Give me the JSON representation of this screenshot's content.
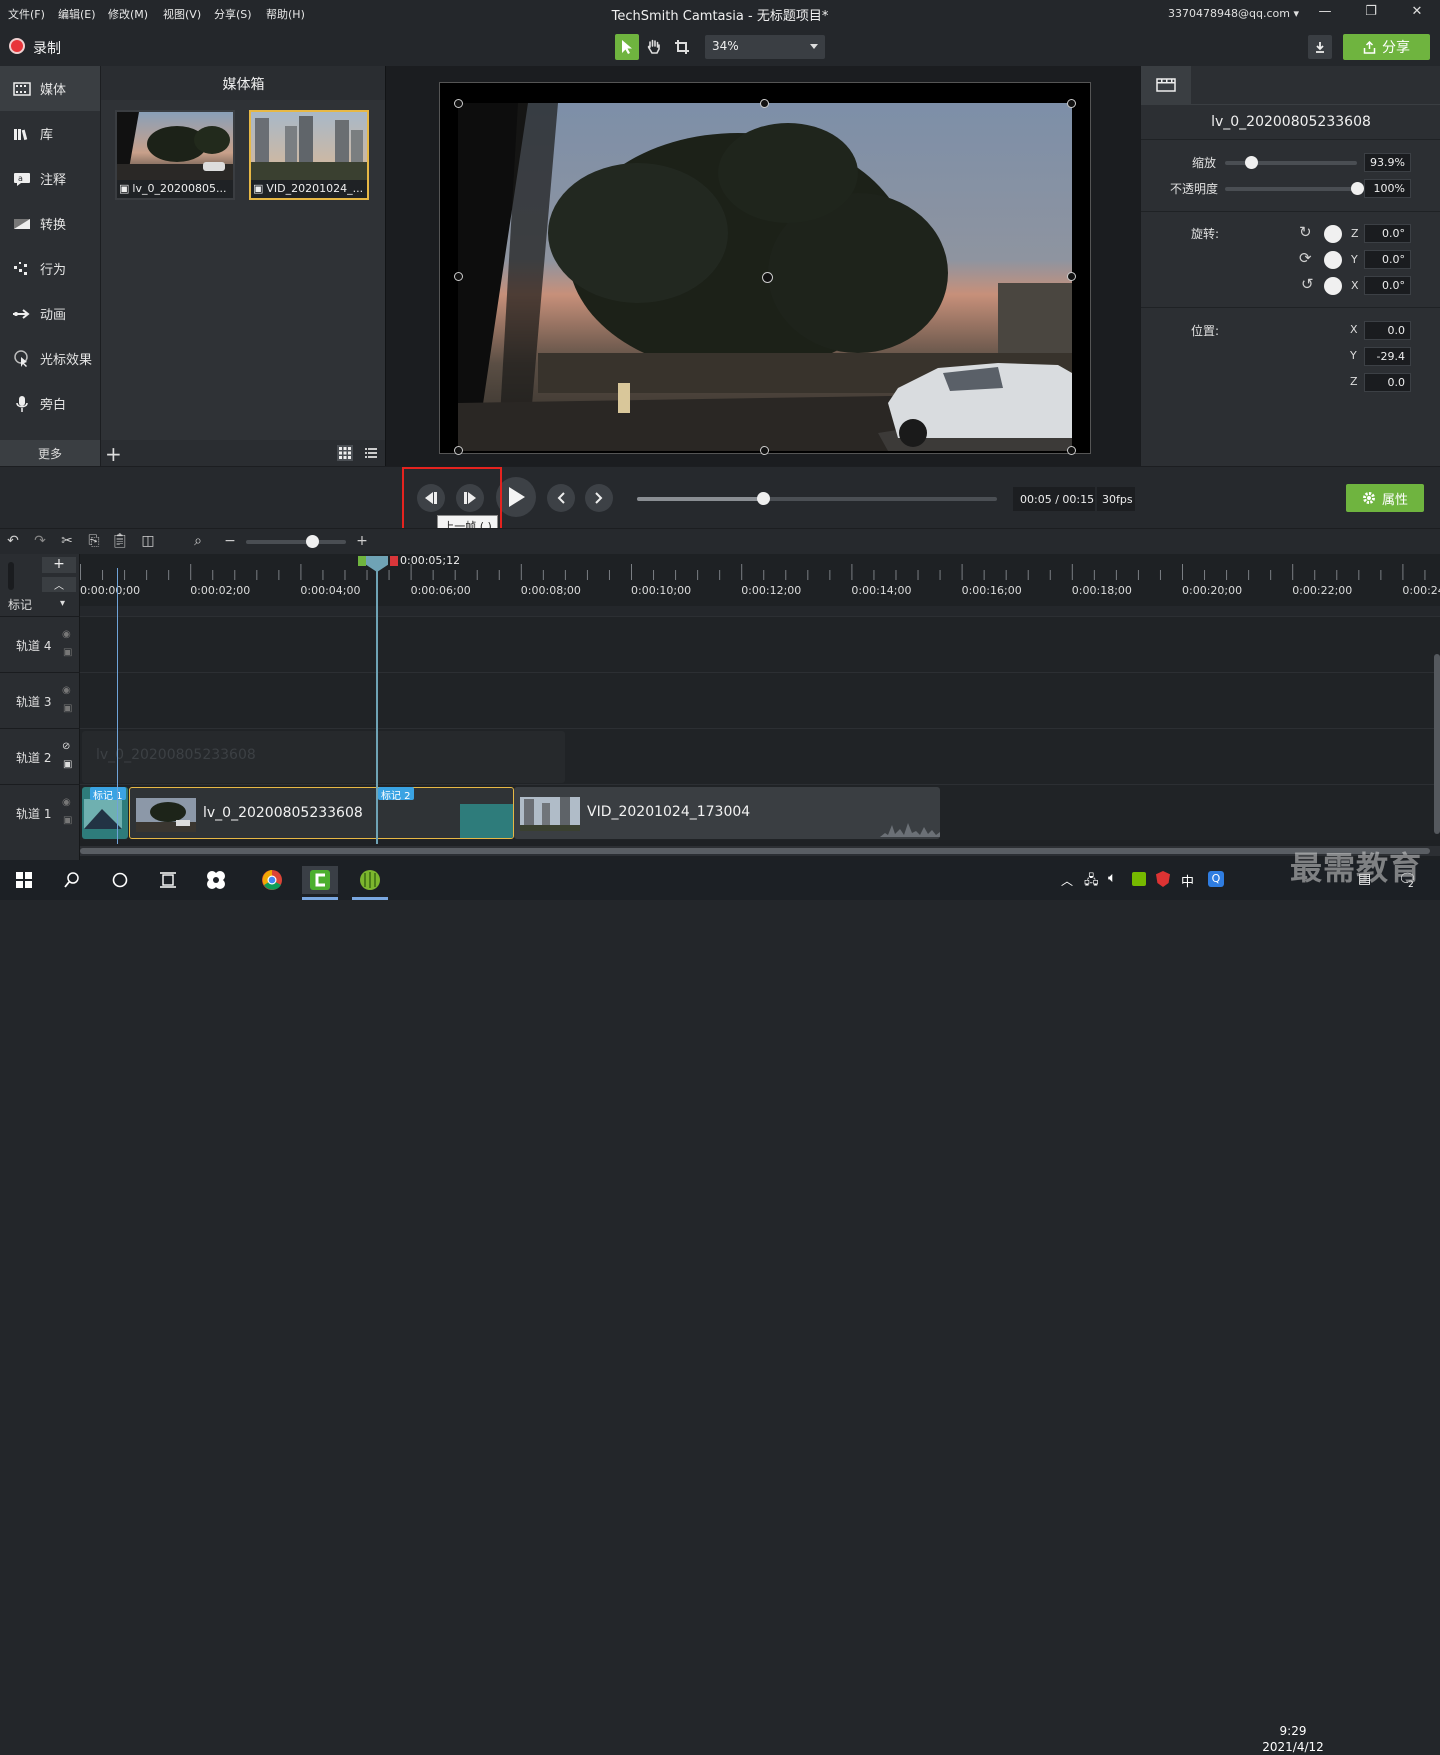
{
  "app": {
    "title": "TechSmith Camtasia - 无标题项目*",
    "menus": [
      "文件(F)",
      "编辑(E)",
      "修改(M)",
      "视图(V)",
      "分享(S)",
      "帮助(H)"
    ],
    "account": "3370478948@qq.com"
  },
  "toolbar": {
    "record_label": "录制",
    "zoom_value": "34%",
    "share_label": "分享"
  },
  "leftnav": {
    "items": [
      {
        "label": "媒体",
        "icon": "film-strip-icon"
      },
      {
        "label": "库",
        "icon": "library-icon"
      },
      {
        "label": "注释",
        "icon": "annotation-icon"
      },
      {
        "label": "转换",
        "icon": "transition-icon"
      },
      {
        "label": "行为",
        "icon": "behavior-icon"
      },
      {
        "label": "动画",
        "icon": "animation-icon"
      },
      {
        "label": "光标效果",
        "icon": "cursor-effect-icon"
      },
      {
        "label": "旁白",
        "icon": "microphone-icon"
      }
    ],
    "more_label": "更多"
  },
  "mediabin": {
    "title": "媒体箱",
    "items": [
      {
        "label": "lv_0_20200805..."
      },
      {
        "label": "VID_20201024_..."
      }
    ]
  },
  "properties": {
    "clip_name": "lv_0_20200805233608",
    "scale_label": "缩放",
    "scale_value": "93.9%",
    "scale_level": 0.2,
    "opacity_label": "不透明度",
    "opacity_value": "100%",
    "opacity_level": 1.0,
    "rotation_label": "旋转:",
    "rotation": [
      {
        "axis": "Z",
        "value": "0.0°"
      },
      {
        "axis": "Y",
        "value": "0.0°"
      },
      {
        "axis": "X",
        "value": "0.0°"
      }
    ],
    "position_label": "位置:",
    "position": [
      {
        "axis": "X",
        "value": "0.0"
      },
      {
        "axis": "Y",
        "value": "-29.4"
      },
      {
        "axis": "Z",
        "value": "0.0"
      }
    ]
  },
  "playback": {
    "tooltip": "上一帧 (,)",
    "progress": 0.35,
    "time_readout": "00:05 / 00:15",
    "fps": "30fps",
    "properties_label": "属性"
  },
  "timeline": {
    "playhead_time": "0:00:05;12",
    "ruler_labels": [
      "0:00:00;00",
      "0:00:02;00",
      "0:00:04;00",
      "0:00:06;00",
      "0:00:08;00",
      "0:00:10;00",
      "0:00:12;00",
      "0:00:14;00",
      "0:00:16;00",
      "0:00:18;00",
      "0:00:20;00",
      "0:00:22;00",
      "0:00:24"
    ],
    "marker_label": "标记",
    "tracks": [
      "轨道 4",
      "轨道 3",
      "轨道 2",
      "轨道 1"
    ],
    "ghost_clip": "lv_0_20200805233608",
    "clips": [
      {
        "label": "lv_0_20200805233608"
      },
      {
        "label": "VID_20201024_173004"
      }
    ],
    "marker_tags": [
      "标记 1",
      "标记 2"
    ]
  },
  "taskbar": {
    "time": "9:29",
    "date": "2021/4/12",
    "ime": "中",
    "notif_count": "2"
  },
  "watermark": "最需教育",
  "colors": {
    "accent": "#6fb43f",
    "record": "#e8353a",
    "highlight": "#e5231f",
    "selected": "#e7b845",
    "playhead": "#6fa3b5"
  }
}
